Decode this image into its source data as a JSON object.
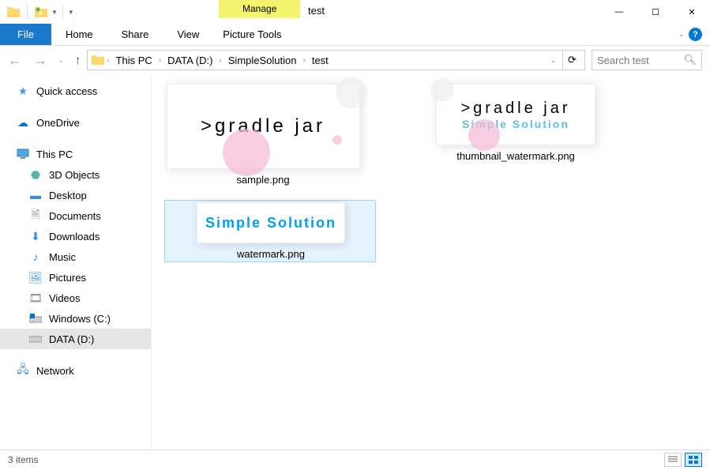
{
  "title": "test",
  "quick_access_checked": true,
  "ribbon": {
    "manage_label": "Manage",
    "file": "File",
    "tabs": [
      "Home",
      "Share",
      "View",
      "Picture Tools"
    ]
  },
  "window_controls": {
    "min": "—",
    "max": "☐",
    "close": "✕"
  },
  "nav": {
    "back": "←",
    "forward": "→",
    "up": "↑"
  },
  "breadcrumb": [
    "This PC",
    "DATA (D:)",
    "SimpleSolution",
    "test"
  ],
  "search_placeholder": "Search test",
  "sidebar": {
    "quick_access": "Quick access",
    "onedrive": "OneDrive",
    "this_pc": "This PC",
    "items": [
      "3D Objects",
      "Desktop",
      "Documents",
      "Downloads",
      "Music",
      "Pictures",
      "Videos",
      "Windows (C:)",
      "DATA (D:)"
    ],
    "network": "Network"
  },
  "files": [
    {
      "name": "sample.png",
      "thumb_text": ">gradle jar",
      "selected": false
    },
    {
      "name": "thumbnail_watermark.png",
      "thumb_text": ">gradle jar",
      "thumb_sub": "Simple Solution",
      "selected": false
    },
    {
      "name": "watermark.png",
      "thumb_sub": "Simple Solution",
      "selected": true
    }
  ],
  "status_text": "3 items"
}
